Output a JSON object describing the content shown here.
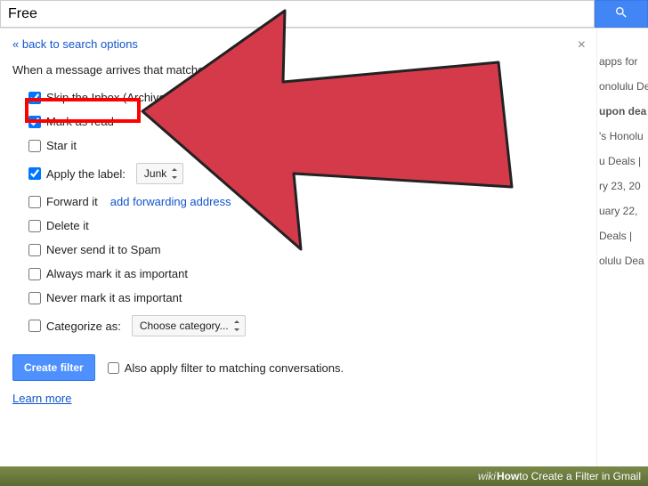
{
  "search": {
    "value": "Free"
  },
  "back_link": "« back to search options",
  "intro": "When a message arrives that matches this search:",
  "options": {
    "skip_inbox": {
      "label": "Skip the Inbox (Archive it)",
      "checked": true
    },
    "mark_read": {
      "label": "Mark as read",
      "checked": true
    },
    "star": {
      "label": "Star it",
      "checked": false
    },
    "apply_label": {
      "label": "Apply the label:",
      "checked": true,
      "value": "Junk"
    },
    "forward": {
      "label": "Forward it",
      "checked": false,
      "link": "add forwarding address"
    },
    "delete": {
      "label": "Delete it",
      "checked": false
    },
    "never_spam": {
      "label": "Never send it to Spam",
      "checked": false
    },
    "always_imp": {
      "label": "Always mark it as important",
      "checked": false
    },
    "never_imp": {
      "label": "Never mark it as important",
      "checked": false
    },
    "categorize": {
      "label": "Categorize as:",
      "checked": false,
      "value": "Choose category..."
    }
  },
  "create_button": "Create filter",
  "also_apply": {
    "label": "Also apply filter to matching conversations.",
    "checked": false
  },
  "learn_more": "Learn more",
  "footer": {
    "prefix": "wiki",
    "bold": "How",
    "rest": " to Create a Filter in Gmail"
  },
  "right_snippets": [
    "apps for",
    "onolulu De",
    "upon dea",
    "'s Honolu",
    "u Deals |",
    "ry 23, 20",
    "uary 22,",
    "Deals |",
    "olulu Dea"
  ]
}
